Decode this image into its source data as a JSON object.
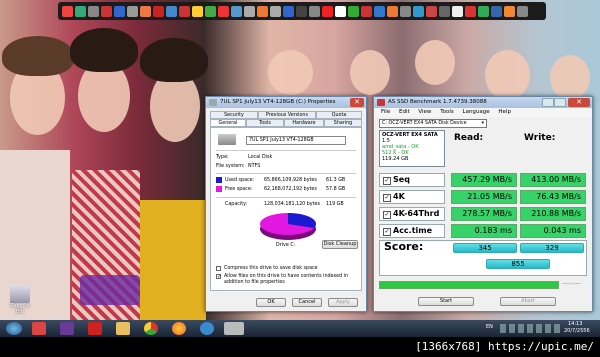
{
  "dock": {
    "icon_colors": [
      "#e44",
      "#3a7",
      "#888",
      "#c33",
      "#36c",
      "#999",
      "#e74",
      "#c22",
      "#48c",
      "#c33",
      "#fc3",
      "#4a4",
      "#e33",
      "#59c",
      "#aaa",
      "#e73",
      "#aaa",
      "#36c",
      "#444",
      "#888",
      "#e22",
      "#fff",
      "#3a3",
      "#c33",
      "#37c",
      "#e73",
      "#888",
      "#39c",
      "#c44",
      "#666",
      "#eee",
      "#d33",
      "#3a5",
      "#36a",
      "#e83",
      "#888"
    ]
  },
  "desktop": {
    "icons": [
      {
        "label": "Recycle Bin"
      }
    ]
  },
  "properties": {
    "title": "7UL SP1 July13 VT4-128GB (C:) Properties",
    "tabs_row1": [
      "Security",
      "Previous Versions",
      "Quota"
    ],
    "tabs_row2": [
      "General",
      "Tools",
      "Hardware",
      "Sharing"
    ],
    "volume_name": "7UL SP1 July13 VT4-128GB",
    "type_label": "Type:",
    "type_value": "Local Disk",
    "fs_label": "File system:",
    "fs_value": "NTFS",
    "used_label": "Used space:",
    "used_bytes": "65,866,109,928 bytes",
    "used_gb": "61.3 GB",
    "free_label": "Free space:",
    "free_bytes": "62,168,072,192 bytes",
    "free_gb": "57.8 GB",
    "capacity_label": "Capacity:",
    "capacity_bytes": "128,034,181,120 bytes",
    "capacity_gb": "119 GB",
    "drive_label": "Drive C:",
    "cleanup_button": "Disk Cleanup",
    "compress_label": "Compress this drive to save disk space",
    "index_label": "Allow files on this drive to have contents indexed in addition to file properties",
    "ok": "OK",
    "cancel": "Cancel",
    "apply": "Apply",
    "used_color": "#1a1ad0",
    "free_color": "#e018e0"
  },
  "asssd": {
    "title": "AS SSD Benchmark 1.7.4739.38088",
    "menu": [
      "File",
      "Edit",
      "View",
      "Tools",
      "Language",
      "Help"
    ],
    "drive_select": "C: OCZ-VERT EX4 SATA Disk Device",
    "info_lines": [
      "OCZ-VERT EX4 SATA",
      "1.5",
      "amd_sata - OK",
      "512 K - OK",
      "119.24 GB"
    ],
    "read_header": "Read:",
    "write_header": "Write:",
    "rows": [
      {
        "label": "Seq",
        "read": "457.29 MB/s",
        "write": "413.00 MB/s"
      },
      {
        "label": "4K",
        "read": "21.05 MB/s",
        "write": "76.43 MB/s"
      },
      {
        "label": "4K-64Thrd",
        "read": "278.57 MB/s",
        "write": "210.88 MB/s"
      },
      {
        "label": "Acc.time",
        "read": "0.183 ms",
        "write": "0.043 ms"
      }
    ],
    "score_label": "Score:",
    "score_read": "345",
    "score_write": "329",
    "score_total": "855",
    "start_button": "Start",
    "abort_button": "Abort",
    "time_text": "---:---:---"
  },
  "taskbar": {
    "lang": "EN",
    "time": "14:13",
    "date": "20/7/2556"
  },
  "caption": "[1366x768] https://upic.me/"
}
